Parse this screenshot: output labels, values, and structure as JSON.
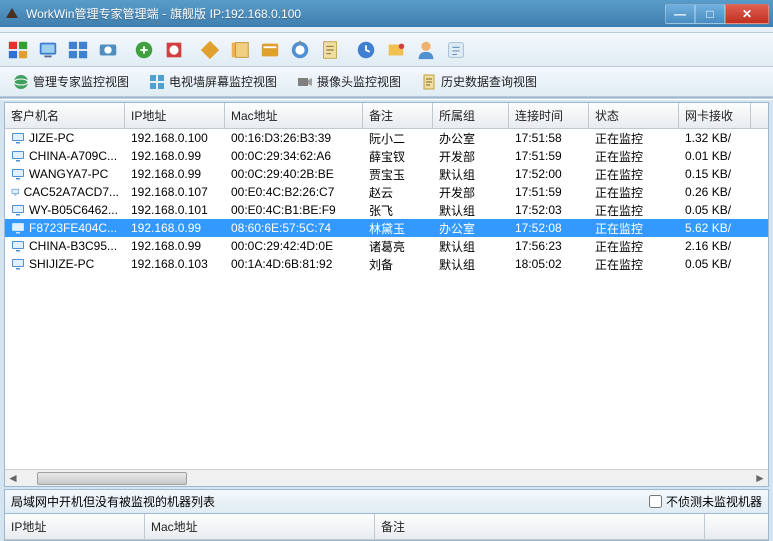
{
  "titlebar": {
    "app_name": "WorkWin管理专家管理端",
    "edition": "旗舰版",
    "ip_label": "IP:192.168.0.100"
  },
  "win_buttons": {
    "min": "—",
    "max": "□",
    "close": "✕"
  },
  "tabs": [
    {
      "label": "管理专家监控视图"
    },
    {
      "label": "电视墙屏幕监控视图"
    },
    {
      "label": "摄像头监控视图"
    },
    {
      "label": "历史数据查询视图"
    }
  ],
  "columns": [
    "客户机名",
    "IP地址",
    "Mac地址",
    "备注",
    "所属组",
    "连接时间",
    "状态",
    "网卡接收"
  ],
  "rows": [
    {
      "name": "JIZE-PC",
      "ip": "192.168.0.100",
      "mac": "00:16:D3:26:B3:39",
      "note": "阮小二",
      "group": "办公室",
      "time": "17:51:58",
      "status": "正在监控",
      "net": "1.32 KB/"
    },
    {
      "name": "CHINA-A709C...",
      "ip": "192.168.0.99",
      "mac": "00:0C:29:34:62:A6",
      "note": "薛宝钗",
      "group": "开发部",
      "time": "17:51:59",
      "status": "正在监控",
      "net": "0.01 KB/"
    },
    {
      "name": "WANGYA7-PC",
      "ip": "192.168.0.99",
      "mac": "00:0C:29:40:2B:BE",
      "note": "贾宝玉",
      "group": "默认组",
      "time": "17:52:00",
      "status": "正在监控",
      "net": "0.15 KB/"
    },
    {
      "name": "CAC52A7ACD7...",
      "ip": "192.168.0.107",
      "mac": "00:E0:4C:B2:26:C7",
      "note": "赵云",
      "group": "开发部",
      "time": "17:51:59",
      "status": "正在监控",
      "net": "0.26 KB/"
    },
    {
      "name": "WY-B05C6462...",
      "ip": "192.168.0.101",
      "mac": "00:E0:4C:B1:BE:F9",
      "note": "张飞",
      "group": "默认组",
      "time": "17:52:03",
      "status": "正在监控",
      "net": "0.05 KB/"
    },
    {
      "name": "F8723FE404C...",
      "ip": "192.168.0.99",
      "mac": "08:60:6E:57:5C:74",
      "note": "林黛玉",
      "group": "办公室",
      "time": "17:52:08",
      "status": "正在监控",
      "net": "5.62 KB/",
      "selected": true
    },
    {
      "name": "CHINA-B3C95...",
      "ip": "192.168.0.99",
      "mac": "00:0C:29:42:4D:0E",
      "note": "诸葛亮",
      "group": "默认组",
      "time": "17:56:23",
      "status": "正在监控",
      "net": "2.16 KB/"
    },
    {
      "name": "SHIJIZE-PC",
      "ip": "192.168.0.103",
      "mac": "00:1A:4D:6B:81:92",
      "note": "刘备",
      "group": "默认组",
      "time": "18:05:02",
      "status": "正在监控",
      "net": "0.05 KB/"
    }
  ],
  "bottom": {
    "title": "局域网中开机但没有被监视的机器列表",
    "checkbox_label": "不侦测未监视机器",
    "columns": [
      "IP地址",
      "Mac地址",
      "备注"
    ]
  },
  "colors": {
    "selection": "#3399ff"
  }
}
